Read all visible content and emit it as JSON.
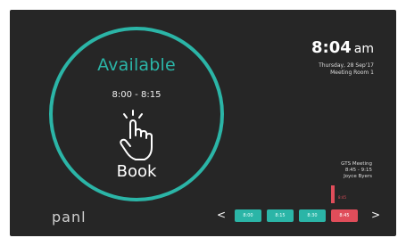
{
  "status": {
    "label": "Available",
    "time_range": "8:00 - 8:15",
    "action": "Book"
  },
  "clock": {
    "time": "8:04",
    "ampm": "am",
    "date": "Thursday, 28 Sep'17",
    "room": "Meeting Room 1"
  },
  "next_meeting": {
    "title": "GTS Meeting",
    "time": "8:45 - 9:15",
    "owner": "Joyce Byers",
    "marker_label": "8:45"
  },
  "timeline": {
    "slots": [
      {
        "label": "8:00",
        "state": "available"
      },
      {
        "label": "8:15",
        "state": "available"
      },
      {
        "label": "8:30",
        "state": "available"
      },
      {
        "label": "8:45",
        "state": "booked"
      }
    ],
    "prev": "<",
    "next": ">"
  },
  "brand": {
    "logo": "panl"
  },
  "colors": {
    "accent": "#2bb5a7",
    "booked": "#e04d5a",
    "background": "#262626"
  },
  "icons": {
    "hand": "tap-hand-icon"
  }
}
